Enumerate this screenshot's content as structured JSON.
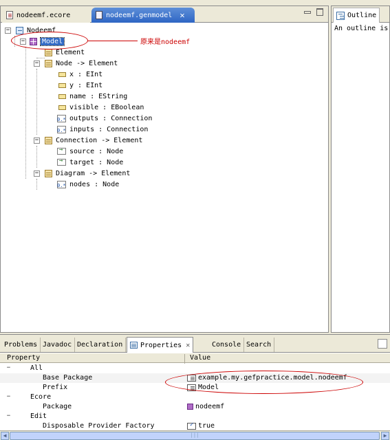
{
  "editor_tabs": [
    {
      "label": "nodeemf.ecore",
      "active": false
    },
    {
      "label": "nodeemf.genmodel",
      "active": true,
      "close": "✕"
    }
  ],
  "tree": {
    "root": "Nodeemf",
    "model": "Model",
    "items": [
      {
        "label": "Element"
      },
      {
        "label": "Node -> Element"
      },
      {
        "label": "x : EInt"
      },
      {
        "label": "y : EInt"
      },
      {
        "label": "name : EString"
      },
      {
        "label": "visible : EBoolean"
      },
      {
        "label": "outputs : Connection"
      },
      {
        "label": "inputs : Connection"
      },
      {
        "label": "Connection -> Element"
      },
      {
        "label": "source : Node"
      },
      {
        "label": "target : Node"
      },
      {
        "label": "Diagram -> Element"
      },
      {
        "label": "nodes : Node"
      }
    ]
  },
  "annotation_note": "原来是nodeemf",
  "outline": {
    "tab_label": "Outline",
    "message": "An outline is"
  },
  "bottom_tabs": [
    "Problems",
    "Javadoc",
    "Declaration",
    "Properties",
    "Console",
    "Search"
  ],
  "properties": {
    "header": {
      "property": "Property",
      "value": "Value"
    },
    "rows": [
      {
        "name": "All",
        "value": ""
      },
      {
        "name": "Base Package",
        "value": "example.my.gefpractice.model.nodeemf"
      },
      {
        "name": "Prefix",
        "value": "Model"
      },
      {
        "name": "Ecore",
        "value": ""
      },
      {
        "name": "Package",
        "value": "nodeemf"
      },
      {
        "name": "Edit",
        "value": ""
      },
      {
        "name": "Disposable Provider Factory",
        "value": "true"
      }
    ]
  },
  "colors": {
    "annotation": "#cc0000",
    "selection": "#316ac5",
    "tab_active": "#2f66c4"
  }
}
